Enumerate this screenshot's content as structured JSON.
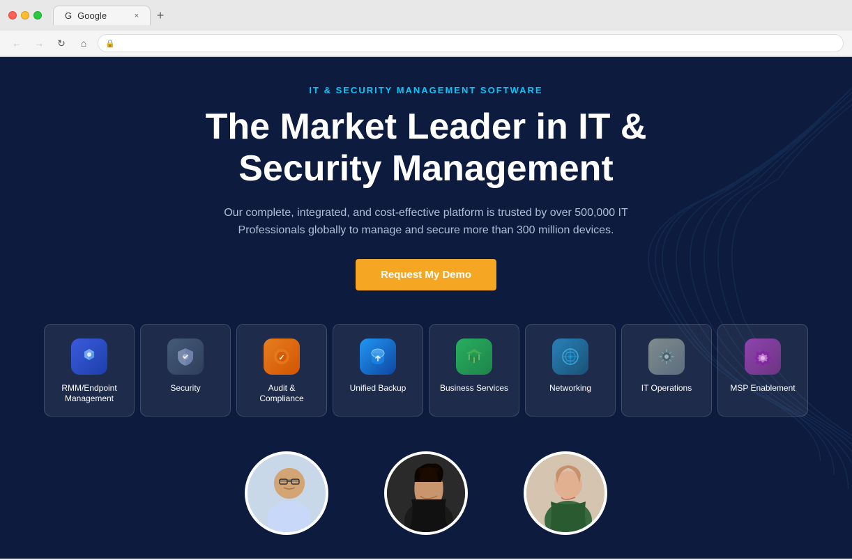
{
  "browser": {
    "tab_title": "Google",
    "url": "",
    "new_tab_icon": "+",
    "close_icon": "×"
  },
  "hero": {
    "eyebrow": "IT & SECURITY MANAGEMENT SOFTWARE",
    "title": "The Market Leader in IT & Security Management",
    "subtitle": "Our complete, integrated, and cost-effective platform is trusted by over 500,000 IT Professionals globally to manage and secure more than 300 million devices.",
    "cta_label": "Request My Demo"
  },
  "feature_cards": [
    {
      "id": "rmm",
      "label": "RMM/Endpoint Management",
      "icon": "🔷",
      "icon_class": "icon-rmm"
    },
    {
      "id": "security",
      "label": "Security",
      "icon": "🛡️",
      "icon_class": "icon-security"
    },
    {
      "id": "audit",
      "label": "Audit & Compliance",
      "icon": "🔶",
      "icon_class": "icon-audit"
    },
    {
      "id": "backup",
      "label": "Unified Backup",
      "icon": "☁️",
      "icon_class": "icon-backup"
    },
    {
      "id": "business",
      "label": "Business Services",
      "icon": "🌐",
      "icon_class": "icon-business"
    },
    {
      "id": "networking",
      "label": "Networking",
      "icon": "🔵",
      "icon_class": "icon-networking"
    },
    {
      "id": "operations",
      "label": "IT Operations",
      "icon": "⚙️",
      "icon_class": "icon-operations"
    },
    {
      "id": "msp",
      "label": "MSP Enablement",
      "icon": "💠",
      "icon_class": "icon-msp"
    }
  ],
  "testimonials": [
    {
      "id": "person1",
      "bg": "#b8cfe0"
    },
    {
      "id": "person2",
      "bg": "#1a1a2e"
    },
    {
      "id": "person3",
      "bg": "#3a5a40"
    }
  ]
}
